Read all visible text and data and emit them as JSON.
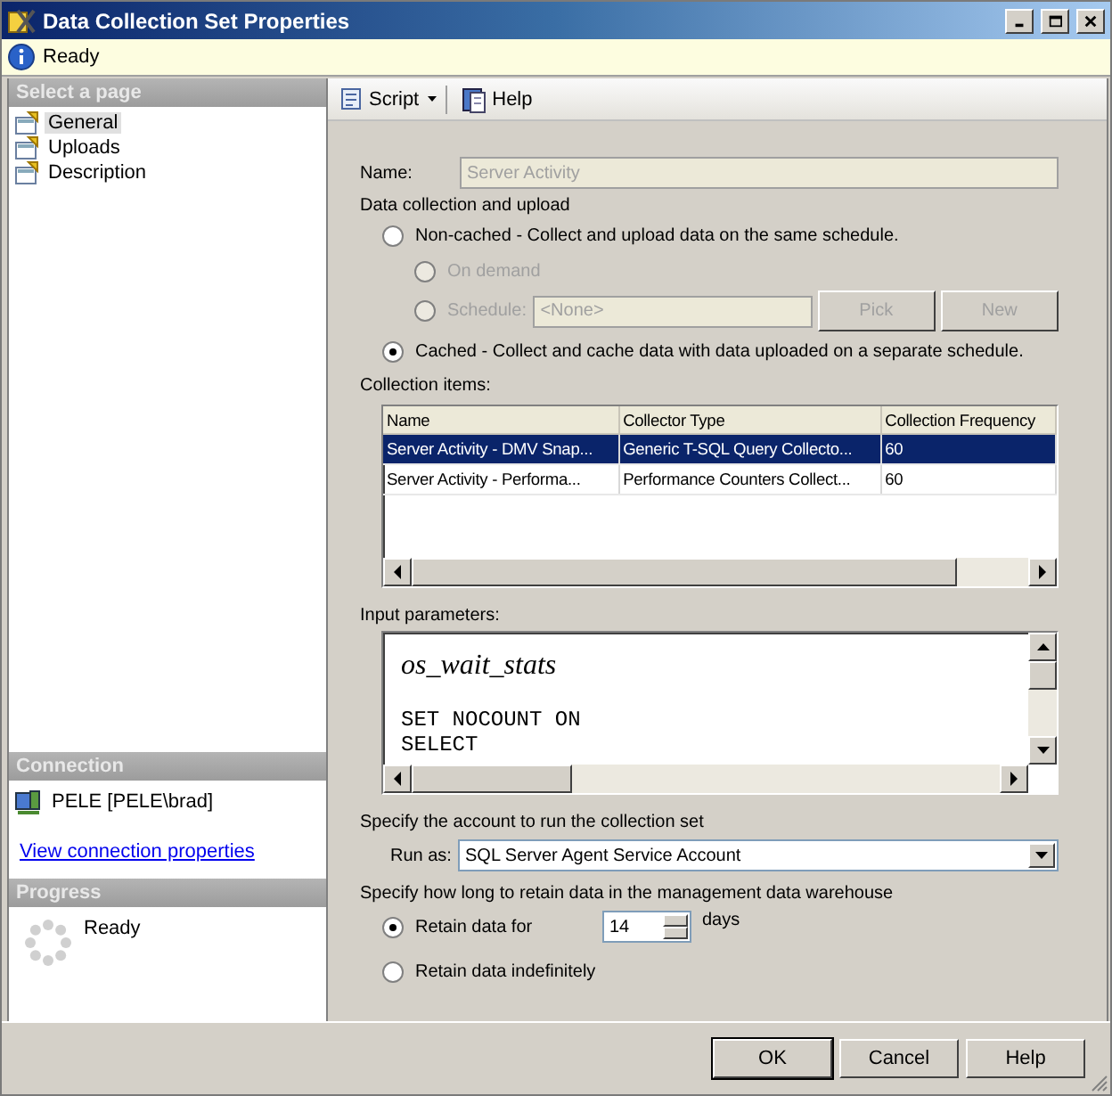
{
  "window": {
    "title": "Data Collection Set Properties"
  },
  "status_bar": {
    "text": "Ready"
  },
  "sidebar": {
    "header": "Select a page",
    "items": [
      {
        "label": "General",
        "selected": true
      },
      {
        "label": "Uploads",
        "selected": false
      },
      {
        "label": "Description",
        "selected": false
      }
    ]
  },
  "connection": {
    "header": "Connection",
    "server": "PELE [PELE\\brad]",
    "link": "View connection properties"
  },
  "progress": {
    "header": "Progress",
    "status": "Ready"
  },
  "toolbar": {
    "items": [
      {
        "label": "Script",
        "kind": "dropdown"
      },
      {
        "label": "Help",
        "kind": "help"
      }
    ]
  },
  "name": {
    "label": "Name:",
    "value": "Server Activity",
    "disabled": true
  },
  "upload": {
    "heading": "Data collection and upload",
    "modes": [
      {
        "label": "Non-cached - Collect and upload data on the same schedule.",
        "selected": false
      },
      {
        "label": "Cached - Collect and cache data with data uploaded on a separate schedule.",
        "selected": true
      }
    ],
    "schedule_options": [
      {
        "label": "On demand",
        "selected": false,
        "disabled": true
      },
      {
        "label": "Schedule:",
        "selected": false,
        "disabled": true
      }
    ],
    "schedule_value": "<None>",
    "schedule_buttons": [
      {
        "label": "Pick",
        "disabled": true
      },
      {
        "label": "New",
        "disabled": true
      }
    ]
  },
  "collection_items": {
    "label": "Collection items:",
    "columns": [
      "Name",
      "Collector Type",
      "Collection Frequency"
    ],
    "rows": [
      {
        "cells": [
          "Server Activity - DMV Snap...",
          "Generic T-SQL Query Collecto...",
          "60"
        ],
        "selected": true
      },
      {
        "cells": [
          "Server Activity - Performa...",
          "Performance Counters Collect...",
          "60"
        ],
        "selected": false
      }
    ]
  },
  "input_parameters": {
    "label": "Input parameters:",
    "title": "os_wait_stats",
    "code": [
      "SET NOCOUNT ON",
      "SELECT"
    ]
  },
  "account": {
    "heading": "Specify the account to run the collection set",
    "label": "Run as:",
    "value": "SQL Server Agent Service Account"
  },
  "retention": {
    "heading": "Specify how long to retain data in the management data warehouse",
    "options": [
      {
        "label": "Retain data for",
        "selected": true
      },
      {
        "label": "Retain data indefinitely",
        "selected": false
      }
    ],
    "days_value": "14",
    "days_unit": "days"
  },
  "buttons": [
    "OK",
    "Cancel",
    "Help"
  ]
}
